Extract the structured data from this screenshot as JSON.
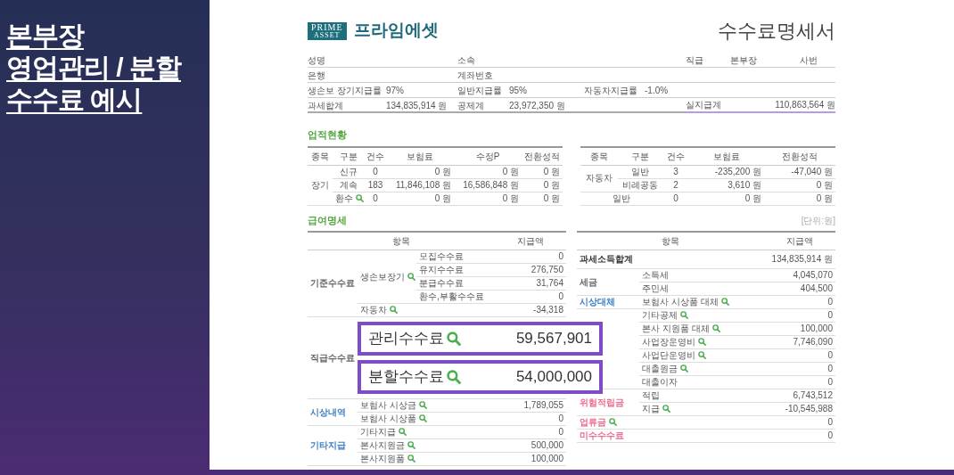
{
  "slide": {
    "title_lines": [
      "본부장",
      "영업관리 / 분할",
      "수수료 예시"
    ]
  },
  "header": {
    "logo_lines": [
      "PRIME",
      "ASSET"
    ],
    "company": "프라임에셋",
    "title": "수수료명세서"
  },
  "info": {
    "name": {
      "label": "성명"
    },
    "affiliation": {
      "label": "소속"
    },
    "grade": {
      "label": "직급",
      "value": "본부장"
    },
    "employee_no": {
      "label": "사번"
    },
    "bank": {
      "label": "은행"
    },
    "account": {
      "label": "계좌번호"
    },
    "life_rate": {
      "label": "생손보 장기지급률",
      "value": "97%"
    },
    "general_rate": {
      "label": "일반지급률",
      "value": "95%"
    },
    "auto_rate": {
      "label": "자동차지급률",
      "value": "-1.0%"
    },
    "taxable_total": {
      "label": "과세합계",
      "value": "134,835,914 원"
    },
    "deduction_total": {
      "label": "공제계",
      "value": "23,972,350 원"
    },
    "net_pay": {
      "label": "실지급계",
      "value": "110,863,564 원"
    }
  },
  "performance": {
    "title": "업적현황",
    "left": {
      "columns": [
        "종목",
        "구분",
        "건수",
        "보험료",
        "수정P",
        "전환성적"
      ],
      "groups": [
        {
          "kind": "group",
          "label": "장기",
          "rows": [
            {
              "cells": [
                "신규",
                "0",
                "0 원",
                "0 원",
                "0 원"
              ]
            },
            {
              "cells": [
                "계속",
                "183",
                "11,846,108 원",
                "16,586,848 원",
                "0 원"
              ]
            },
            {
              "cells": [
                "환수",
                "0",
                "0 원",
                "0 원",
                "0 원"
              ],
              "search": true
            }
          ]
        }
      ]
    },
    "right": {
      "columns": [
        "종목",
        "구분",
        "건수",
        "보험료",
        "전환성적"
      ],
      "groups": [
        {
          "kind": "group",
          "label": "자동차",
          "rows": [
            {
              "cells": [
                "일반",
                "3",
                "-235,200 원",
                "-47,040 원"
              ]
            },
            {
              "cells": [
                "비례공동",
                "2",
                "3,610 원",
                "0 원"
              ]
            }
          ]
        },
        {
          "kind": "single",
          "label": "일반",
          "cells": [
            "0",
            "0 원",
            "0 원"
          ]
        }
      ]
    }
  },
  "salary": {
    "title": "급여명세",
    "unit": "[단위:원]",
    "left": {
      "columns": [
        "항목",
        "지급액"
      ],
      "groups": [
        {
          "kind": "group",
          "label": "기준수수료",
          "color": "#666666",
          "rows": [
            {
              "label": "생손보장기",
              "search": true,
              "rows": [
                {
                  "label": "모집수수료",
                  "amount": "0"
                },
                {
                  "label": "유지수수료",
                  "amount": "276,750"
                },
                {
                  "label": "분급수수료",
                  "amount": "31,764"
                },
                {
                  "label": "환수,부활수수료",
                  "amount": "0"
                }
              ]
            },
            {
              "label": "자동차",
              "search": true,
              "amount": "-34,318"
            }
          ]
        },
        {
          "kind": "highlight",
          "label": "직급수수료",
          "color": "#666666",
          "highlights": [
            {
              "label": "관리수수료",
              "search": true,
              "amount": "59,567,901"
            },
            {
              "label": "분할수수료",
              "search": true,
              "amount": "54,000,000"
            }
          ]
        },
        {
          "kind": "group",
          "label": "시상내역",
          "color": "#3d7fc4",
          "rows": [
            {
              "label": "보험사 시상금",
              "search": true,
              "amount": "1,789,055"
            },
            {
              "label": "보험사 시상품",
              "search": true,
              "amount": "0"
            }
          ]
        },
        {
          "kind": "group",
          "label": "기타지급",
          "color": "#3d7fc4",
          "rows": [
            {
              "label": "기타지급",
              "search": true,
              "amount": "0"
            },
            {
              "label": "본사지원금",
              "search": true,
              "amount": "500,000"
            },
            {
              "label": "본사지원품",
              "search": true,
              "amount": "100,000"
            }
          ]
        }
      ]
    },
    "right": {
      "columns": [
        "항목",
        "지급액"
      ],
      "groups": [
        {
          "kind": "total",
          "label": "과세소득합계",
          "color": "#333333",
          "amount": "134,835,914 원"
        },
        {
          "kind": "group",
          "label": "세금",
          "color": "#666666",
          "rows": [
            {
              "label": "소득세",
              "amount": "4,045,070"
            },
            {
              "label": "주민세",
              "amount": "404,500"
            }
          ]
        },
        {
          "kind": "group",
          "label": "시상대체",
          "color": "#3d7fc4",
          "rows": [
            {
              "label": "보험사 시상품 대체",
              "search": true,
              "amount": "0"
            }
          ]
        },
        {
          "kind": "group",
          "rows": [
            {
              "label": "기타공제",
              "search": true,
              "amount": "0"
            },
            {
              "label": "본사 지원품 대체",
              "search": true,
              "amount": "100,000"
            },
            {
              "label": "사업장운영비",
              "search": true,
              "amount": "7,746,090"
            },
            {
              "label": "사업단운영비",
              "search": true,
              "amount": "0"
            },
            {
              "label": "대출원금",
              "search": true,
              "amount": "0"
            },
            {
              "label": "대출이자",
              "amount": "0"
            }
          ]
        },
        {
          "kind": "group",
          "label": "위험적립금",
          "color": "#ec6c8f",
          "rows": [
            {
              "label": "적립",
              "amount": "6,743,512"
            },
            {
              "label": "지급",
              "search": true,
              "amount": "-10,545,988"
            }
          ]
        },
        {
          "kind": "single",
          "label": "업류금",
          "color": "#ec6c8f",
          "search": true,
          "amount": "0"
        },
        {
          "kind": "single",
          "label": "미수수수료",
          "color": "#ec6c8f",
          "amount": "0"
        }
      ]
    }
  }
}
